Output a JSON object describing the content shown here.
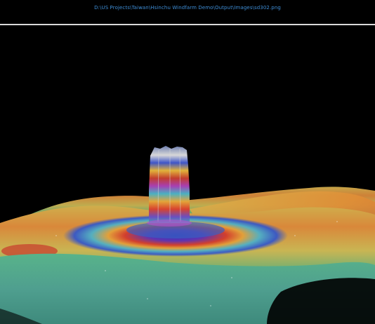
{
  "window": {
    "title": "D:\\US Projects\\Taiwan\\Hsinchu Windfarm Demo\\Output\\Images\\sd302.png"
  },
  "viewport": {
    "background": "#000000",
    "icon": "sonar-3d-point-cloud"
  },
  "colors": {
    "title_text": "#3f8fd8",
    "divider": "#d9d9d9",
    "seafloor_red": "#d2462a",
    "seafloor_orange": "#e08a2e",
    "seafloor_yellow": "#cdbb4a",
    "seafloor_green": "#5fa86a",
    "seafloor_cyan": "#4fb3a8",
    "seafloor_blue": "#3a5fc0",
    "seafloor_magenta": "#9a3fb0"
  }
}
